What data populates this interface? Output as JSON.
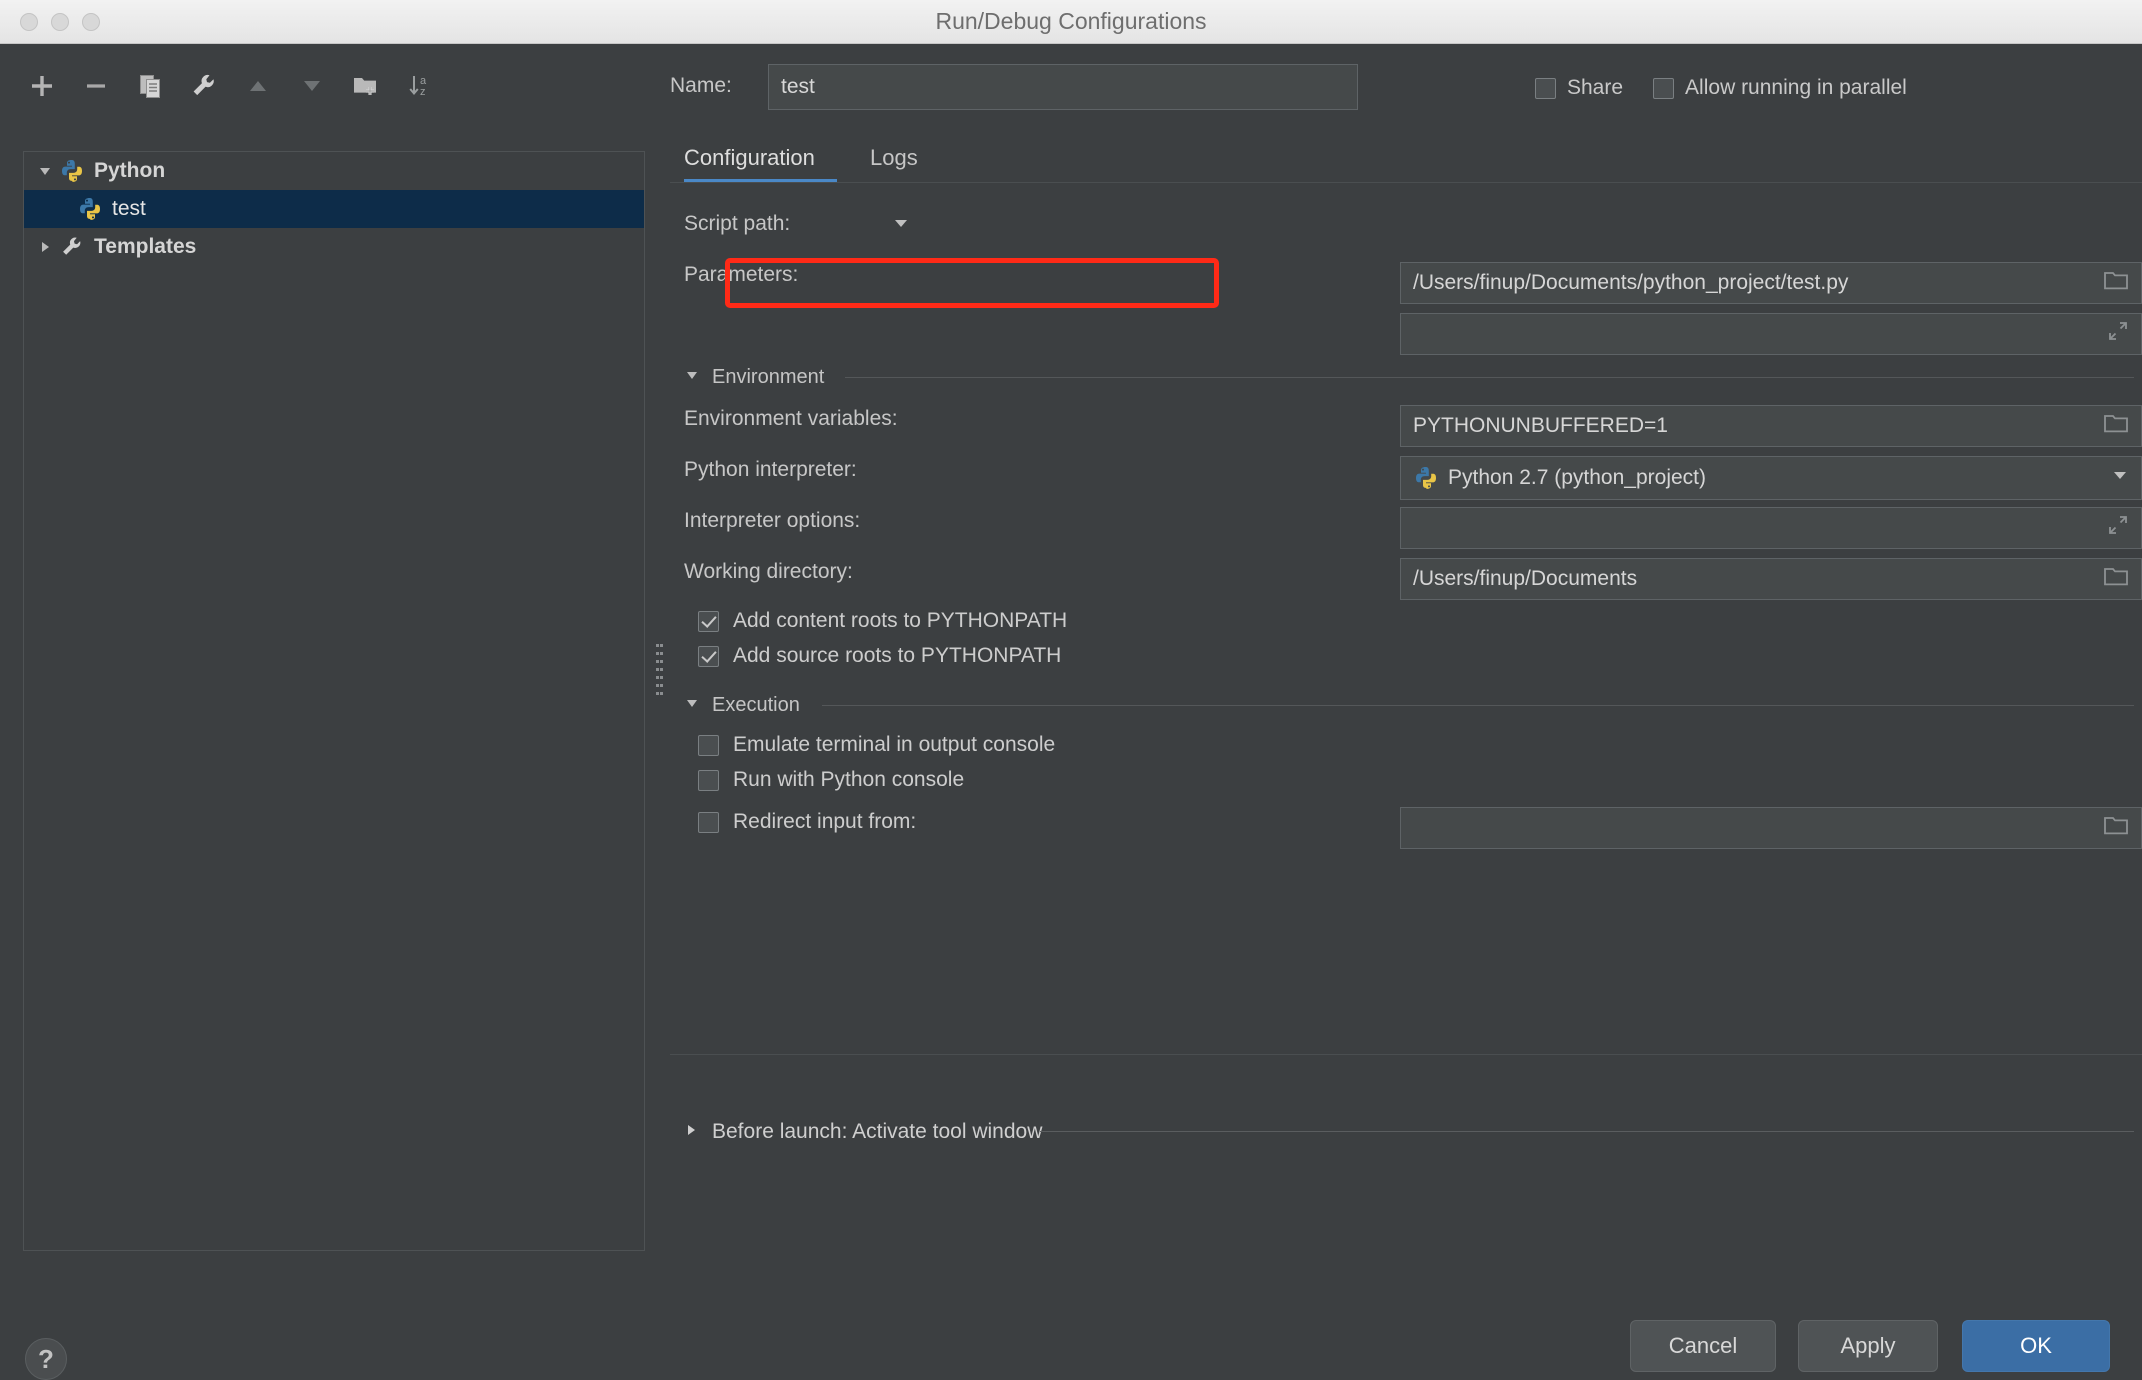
{
  "window": {
    "title": "Run/Debug Configurations",
    "traffic_lights": [
      "close",
      "minimize",
      "zoom"
    ]
  },
  "left_panel": {
    "toolbar": [
      {
        "name": "add-button",
        "icon": "plus-icon",
        "label": "Add New Configuration"
      },
      {
        "name": "remove-button",
        "icon": "minus-icon",
        "label": "Remove Configuration"
      },
      {
        "name": "copy-button",
        "icon": "copy-icon",
        "label": "Copy Configuration"
      },
      {
        "name": "edit-templates-button",
        "icon": "wrench-icon",
        "label": "Edit Templates"
      },
      {
        "name": "move-up-button",
        "icon": "arrow-up-icon",
        "label": "Move Up"
      },
      {
        "name": "move-down-button",
        "icon": "arrow-down-icon",
        "label": "Move Down"
      },
      {
        "name": "new-folder-button",
        "icon": "new-folder-icon",
        "label": "Create New Folder"
      },
      {
        "name": "sort-button",
        "icon": "sort-alphabetical-icon",
        "label": "Sort Configurations"
      }
    ],
    "tree": [
      {
        "label": "Python",
        "icon": "python-icon",
        "twisty": "expanded",
        "level": 0,
        "selected": false,
        "bold": true
      },
      {
        "label": "test",
        "icon": "python-icon",
        "twisty": "none",
        "level": 1,
        "selected": true,
        "bold": false
      },
      {
        "label": "Templates",
        "icon": "wrench-icon",
        "twisty": "collapsed",
        "level": 0,
        "selected": false,
        "bold": true
      }
    ]
  },
  "header": {
    "name_label": "Name:",
    "name_value": "test",
    "share_label": "Share",
    "share_checked": false,
    "parallel_label": "Allow running in parallel",
    "parallel_checked": false
  },
  "tabs": [
    {
      "label": "Configuration",
      "active": true
    },
    {
      "label": "Logs",
      "active": false
    }
  ],
  "form": {
    "script_path": {
      "label": "Script path:",
      "value": "/Users/finup/Documents/python_project/test.py",
      "dropdown_icon": "chevron-down-icon",
      "browse_icon": "folder-icon",
      "highlighted": true
    },
    "parameters": {
      "label": "Parameters:",
      "value": "",
      "expand_icon": "expand-arrows-icon"
    },
    "environment_section": {
      "label": "Environment",
      "twisty": "expanded"
    },
    "environment_variables": {
      "label": "Environment variables:",
      "value": "PYTHONUNBUFFERED=1",
      "browse_icon": "folder-icon"
    },
    "python_interpreter": {
      "label": "Python interpreter:",
      "value": "Python 2.7 (python_project)",
      "value_icon": "python-icon",
      "dropdown_icon": "chevron-down-icon"
    },
    "interpreter_options": {
      "label": "Interpreter options:",
      "value": "",
      "expand_icon": "expand-arrows-icon"
    },
    "working_directory": {
      "label": "Working directory:",
      "value": "/Users/finup/Documents",
      "browse_icon": "folder-icon"
    },
    "add_content_roots": {
      "label": "Add content roots to PYTHONPATH",
      "checked": true
    },
    "add_source_roots": {
      "label": "Add source roots to PYTHONPATH",
      "checked": true
    },
    "execution_section": {
      "label": "Execution",
      "twisty": "expanded"
    },
    "emulate_terminal": {
      "label": "Emulate terminal in output console",
      "checked": false
    },
    "run_with_python_console": {
      "label": "Run with Python console",
      "checked": false
    },
    "redirect_input": {
      "label": "Redirect input from:",
      "checked": false,
      "value": "",
      "browse_icon": "folder-icon"
    },
    "before_launch": {
      "label": "Before launch: Activate tool window",
      "twisty": "collapsed"
    }
  },
  "footer": {
    "help_label": "?",
    "cancel_label": "Cancel",
    "apply_label": "Apply",
    "ok_label": "OK"
  },
  "colors": {
    "background": "#3c3f41",
    "field_background": "#45494a",
    "selection": "#0d2c49",
    "accent": "#4a88c7",
    "primary_button": "#3b6ea5",
    "highlight": "#ff2a17",
    "python_blue": "#3c78a8",
    "python_yellow": "#e9c547"
  }
}
